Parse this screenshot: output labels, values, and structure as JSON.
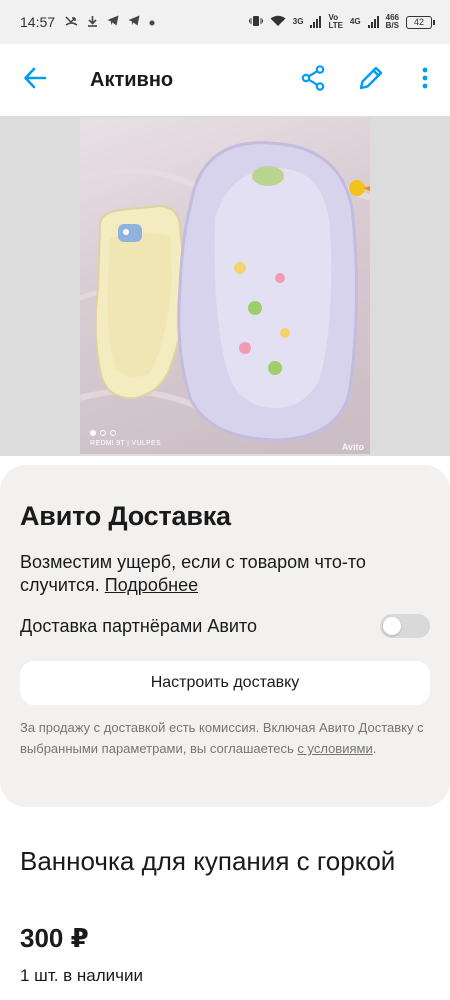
{
  "status_bar": {
    "time": "14:57",
    "net_speed_value": "466",
    "net_speed_unit": "B/S",
    "battery": "42",
    "signal1": "3G",
    "signal2_top": "Vo",
    "signal2_bottom": "LTE",
    "signal3": "4G"
  },
  "toolbar": {
    "title": "Активно",
    "icons": {
      "back": "arrow-left-icon",
      "share": "share-icon",
      "edit": "pencil-icon",
      "more": "more-vertical-icon"
    },
    "accent_color": "#009cf0"
  },
  "gallery": {
    "photo_count": 3,
    "active_index": 0,
    "camera_watermark": "REDMI 9T | VULPES",
    "site_watermark": "Avito"
  },
  "delivery": {
    "title": "Авито Доставка",
    "description": "Возместим ущерб, если с товаром что-то случится.",
    "more_link": "Подробнее",
    "toggle_label": "Доставка партнёрами Авито",
    "toggle_on": false,
    "setup_button": "Настроить доставку",
    "note": "За продажу с доставкой есть комиссия. Включая Авито Доставку с выбранными параметрами, вы соглашаетесь",
    "note_link": "с условиями",
    "note_end": "."
  },
  "listing": {
    "title": "Ванночка для купания с горкой",
    "price": "300 ₽",
    "stock": "1 шт. в наличии"
  }
}
